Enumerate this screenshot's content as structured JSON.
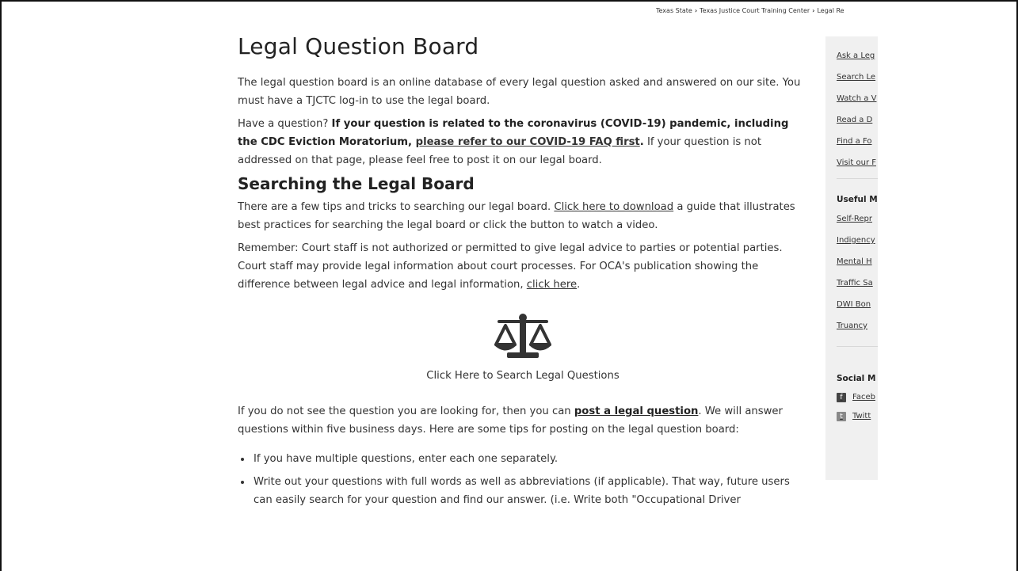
{
  "breadcrumb": {
    "items": [
      "Texas State",
      "Texas Justice Court Training Center",
      "Legal Re"
    ]
  },
  "main": {
    "title": "Legal Question Board",
    "intro": "The legal question board is an online database of every legal question asked and answered on our site. You must have a TJCTC log-in to use the legal board.",
    "question_p": {
      "t1": "Have a question? ",
      "bold1": "If your question is related to the coronavirus (COVID-19) pandemic, including the CDC Eviction Moratorium, ",
      "link": "please refer to our COVID-19 FAQ first",
      "bold2": ".",
      "t2": " If your question is not addressed on that page, please feel free to post it on our legal board."
    },
    "search_heading": "Searching the Legal Board",
    "tips_p": {
      "t1": "There are a few tips and tricks to searching our legal board. ",
      "link": "Click here to download",
      "t2": " a guide that illustrates best practices for searching the legal board or click the button to watch a video."
    },
    "remember_p": {
      "t1": "Remember: Court staff is not authorized or permitted to give legal advice to parties or potential parties. Court staff may provide legal information about court processes. For OCA's publication showing the difference between legal advice and legal information, ",
      "link": "click here",
      "t2": "."
    },
    "search_button_label": "Click Here to Search Legal Questions",
    "post_p": {
      "t1": "If you do not see the question you are looking for, then you can ",
      "link": "post a legal question",
      "t2": ". We will answer questions within five business days. Here are some tips for posting on the legal question board:"
    },
    "bullets": [
      "If you have multiple questions, enter each one separately.",
      "Write out your questions with full words as well as abbreviations (if applicable). That way, future users can easily search for your question and find our answer. (i.e. Write both \"Occupational Driver"
    ]
  },
  "sidebar": {
    "links": [
      "Ask a Leg",
      "Search Le",
      "Watch a V",
      "Read a D",
      "Find a Fo",
      "Visit our F"
    ],
    "useful_heading": "Useful M",
    "useful_links": [
      "Self-Repr",
      "Indigency",
      "Mental H",
      "Traffic Sa",
      "DWI Bon",
      "Truancy"
    ],
    "social_heading": "Social M",
    "social_links": [
      "Faceb",
      "Twitt"
    ]
  },
  "colors": {
    "text": "#333333",
    "sidebar_bg": "#f0f0f0",
    "icon": "#333333"
  }
}
